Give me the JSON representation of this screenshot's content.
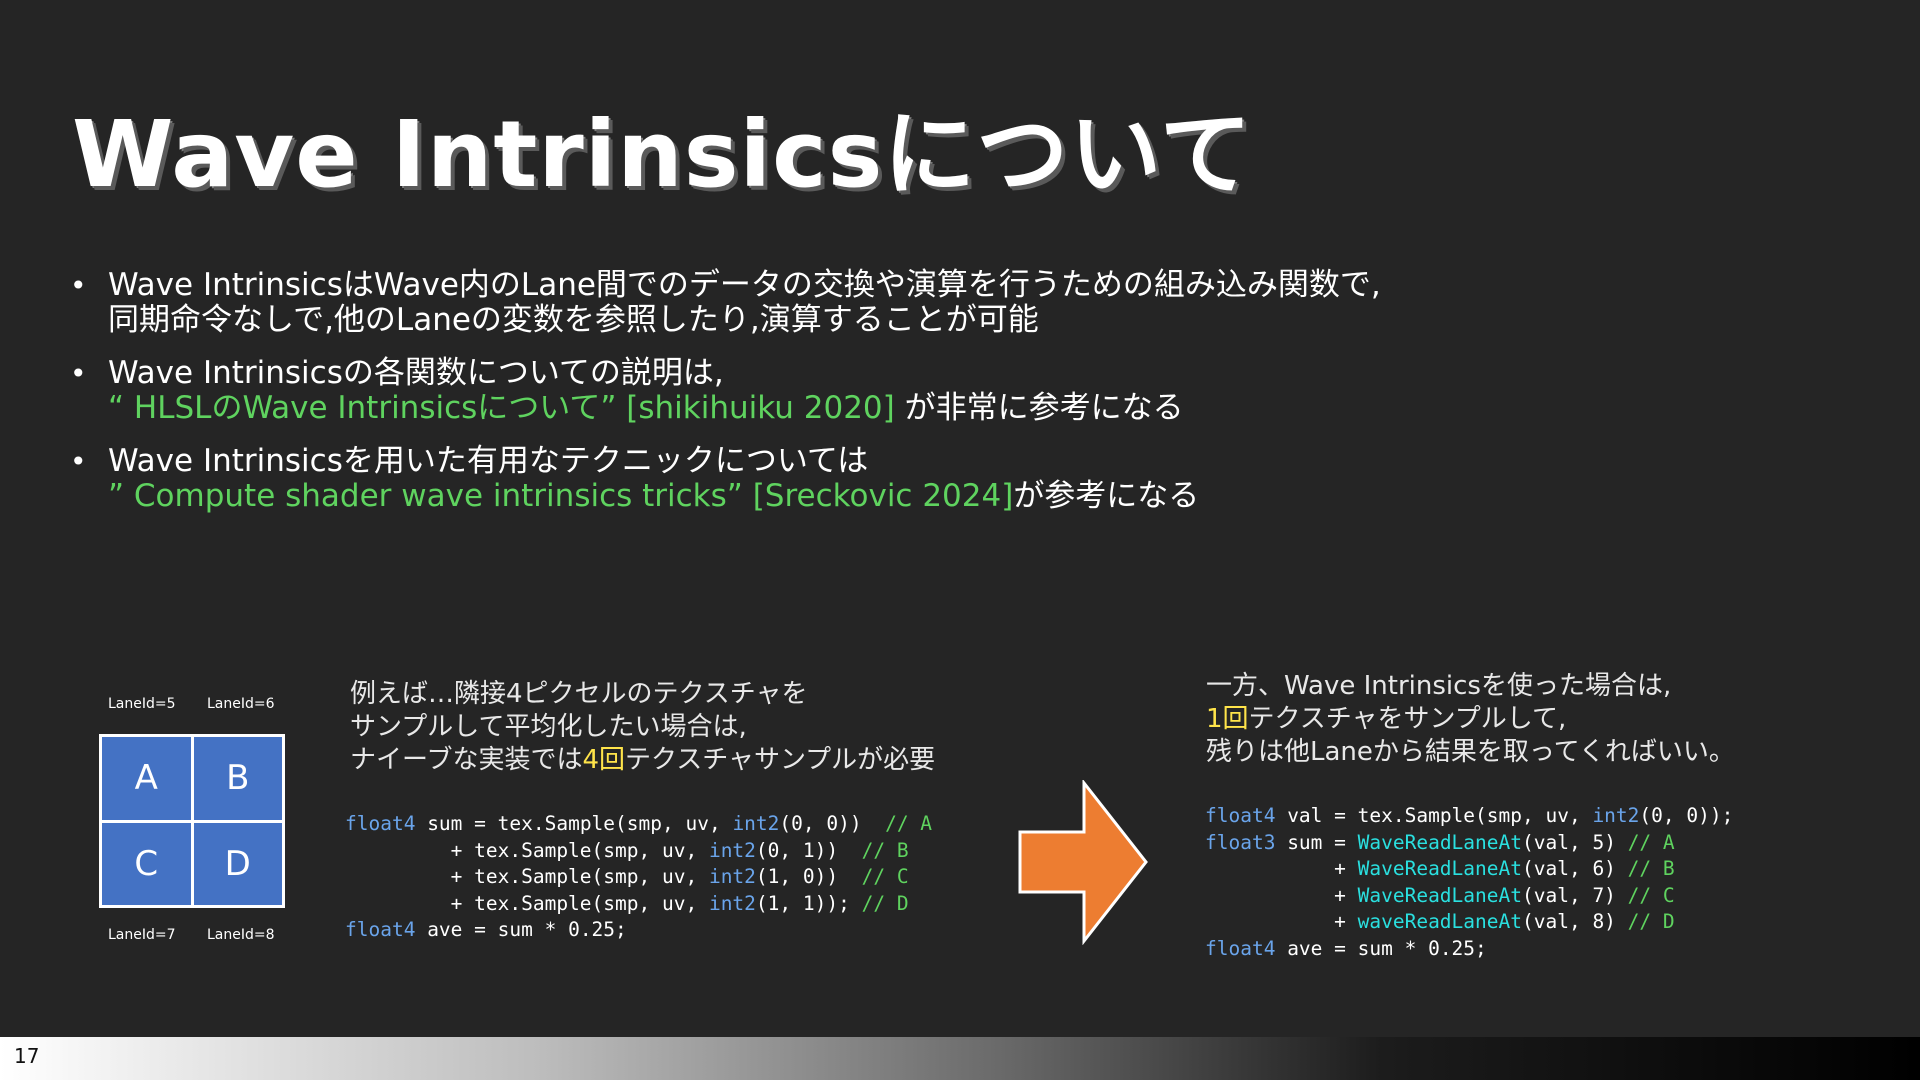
{
  "slide": {
    "title": "Wave Intrinsicsについて",
    "page_number": "17",
    "bullets": [
      {
        "line1": "Wave IntrinsicsはWave内のLane間でのデータの交換や演算を行うための組み込み関数で,",
        "line2": "同期命令なしで,他のLaneの変数を参照したり,演算することが可能"
      },
      {
        "line1": "Wave Intrinsicsの各関数についての説明は,",
        "line2_ref": "“ HLSLのWave Intrinsicsについて” [shikihuiku 2020]",
        "line2_rest": " が非常に参考になる"
      },
      {
        "line1": "Wave Intrinsicsを用いた有用なテクニックについては",
        "line2_ref": "” Compute shader wave intrinsics tricks” [Sreckovic 2024]",
        "line2_rest": "が参考になる"
      }
    ]
  },
  "diagram": {
    "lane_labels": {
      "top_left": "LaneId=5",
      "top_right": "LaneId=6",
      "bottom_left": "LaneId=7",
      "bottom_right": "LaneId=8"
    },
    "cells": [
      "A",
      "B",
      "C",
      "D"
    ]
  },
  "left_note": {
    "line1": "例えば…隣接4ピクセルのテクスチャを",
    "line2": "サンプルして平均化したい場合は,",
    "line3_pre": "ナイーブな実装では",
    "line3_hl": "4回",
    "line3_post": "テクスチャサンプルが必要"
  },
  "right_note": {
    "line1": "一方、Wave Intrinsicsを使った場合は,",
    "line2_hl": "1回",
    "line2_post": "テクスチャをサンプルして,",
    "line3": "残りは他Laneから結果を取ってくればいい。"
  },
  "left_code": {
    "l1_kw": "float4",
    "l1_a": " sum = tex.Sample(smp, uv, ",
    "l1_fn": "int2",
    "l1_b": "(0, 0))  ",
    "l1_c": "// A",
    "l2_a": "         + tex.Sample(smp, uv, ",
    "l2_fn": "int2",
    "l2_b": "(0, 1))  ",
    "l2_c": "// B",
    "l3_a": "         + tex.Sample(smp, uv, ",
    "l3_fn": "int2",
    "l3_b": "(1, 0))  ",
    "l3_c": "// C",
    "l4_a": "         + tex.Sample(smp, uv, ",
    "l4_fn": "int2",
    "l4_b": "(1, 1)); ",
    "l4_c": "// D",
    "l5_kw": "float4",
    "l5_a": " ave = sum * 0.25;"
  },
  "right_code": {
    "l1_kw": "float4",
    "l1_a": " val = tex.Sample(smp, uv, ",
    "l1_fn": "int2",
    "l1_b": "(0, 0));",
    "l2_kw": "float3",
    "l2_a": " sum = ",
    "l2_fn": "WaveReadLaneAt",
    "l2_b": "(val, 5) ",
    "l2_c": "// A",
    "l3_a": "           + ",
    "l3_fn": "WaveReadLaneAt",
    "l3_b": "(val, 6) ",
    "l3_c": "// B",
    "l4_a": "           + ",
    "l4_fn": "WaveReadLaneAt",
    "l4_b": "(val, 7) ",
    "l4_c": "// C",
    "l5_a": "           + ",
    "l5_fn": "waveReadLaneAt",
    "l5_b": "(val, 8) ",
    "l5_c": "// D",
    "l6_kw": "float4",
    "l6_a": " ave = sum * 0.25;"
  },
  "colors": {
    "background": "#252525",
    "reference_green": "#5fd35f",
    "highlight_yellow": "#ffe44a",
    "cell_blue": "#4472c4",
    "arrow_orange": "#ed7d31",
    "keyword_blue": "#6aa4ea",
    "function_cyan": "#2ae0e0"
  },
  "icons": {
    "arrow": "right-arrow-icon"
  }
}
